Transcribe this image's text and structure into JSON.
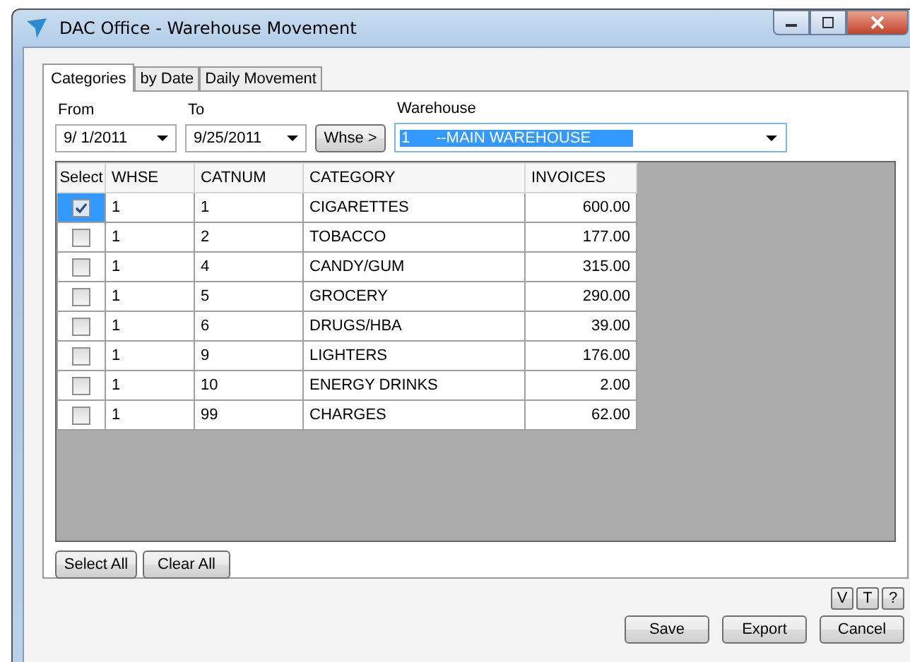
{
  "window": {
    "title": "DAC Office - Warehouse Movement"
  },
  "tabs": [
    {
      "label": "Categories",
      "selected": true
    },
    {
      "label": "by Date",
      "selected": false
    },
    {
      "label": "Daily Movement",
      "selected": false
    }
  ],
  "filters": {
    "from_label": "From",
    "from_value": "9/  1/2011",
    "to_label": "To",
    "to_value": "9/25/2011",
    "whse_button": "Whse >",
    "warehouse_label": "Warehouse",
    "warehouse_value": "1      --MAIN WAREHOUSE"
  },
  "table": {
    "columns": [
      "Select",
      "WHSE",
      "CATNUM",
      "CATEGORY",
      "INVOICES"
    ],
    "rows": [
      {
        "checked": true,
        "selected": true,
        "whse": "1",
        "catnum": "1",
        "category": "CIGARETTES",
        "invoices": "600.00"
      },
      {
        "checked": false,
        "selected": false,
        "whse": "1",
        "catnum": "2",
        "category": "TOBACCO",
        "invoices": "177.00"
      },
      {
        "checked": false,
        "selected": false,
        "whse": "1",
        "catnum": "4",
        "category": "CANDY/GUM",
        "invoices": "315.00"
      },
      {
        "checked": false,
        "selected": false,
        "whse": "1",
        "catnum": "5",
        "category": "GROCERY",
        "invoices": "290.00"
      },
      {
        "checked": false,
        "selected": false,
        "whse": "1",
        "catnum": "6",
        "category": "DRUGS/HBA",
        "invoices": "39.00"
      },
      {
        "checked": false,
        "selected": false,
        "whse": "1",
        "catnum": "9",
        "category": "LIGHTERS",
        "invoices": "176.00"
      },
      {
        "checked": false,
        "selected": false,
        "whse": "1",
        "catnum": "10",
        "category": "ENERGY DRINKS",
        "invoices": "2.00"
      },
      {
        "checked": false,
        "selected": false,
        "whse": "1",
        "catnum": "99",
        "category": "CHARGES",
        "invoices": "62.00"
      }
    ]
  },
  "grid_buttons": [
    "Select All",
    "Clear All"
  ],
  "small_buttons": [
    "V",
    "T",
    "?"
  ],
  "buttons": [
    "Save",
    "Export",
    "Cancel"
  ]
}
